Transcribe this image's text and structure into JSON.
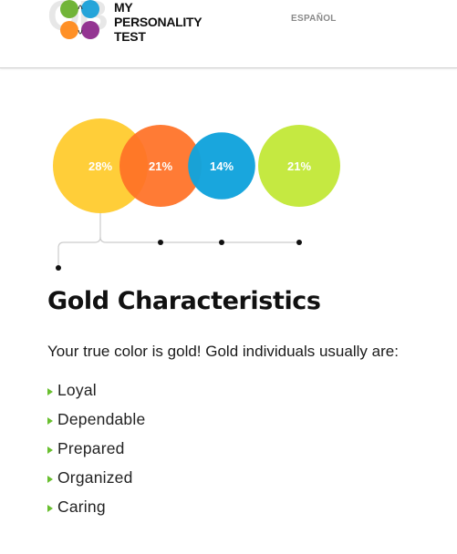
{
  "header": {
    "logo_lines": [
      "MY",
      "PERSONALITY",
      "TEST"
    ],
    "language_link": "ESPAÑOL",
    "colors": {
      "green": "#6ab12e",
      "blue": "#1aa0d8",
      "orange": "#ff8a1a",
      "purple": "#8e2a8c"
    }
  },
  "chart_data": {
    "type": "bubble",
    "bubbles": [
      {
        "label": "28%",
        "value": 28,
        "color": "#ffcc33"
      },
      {
        "label": "21%",
        "value": 21,
        "color": "#ff7126"
      },
      {
        "label": "14%",
        "value": 14,
        "color": "#12a3dc"
      },
      {
        "label": "21%",
        "value": 21,
        "color": "#c3e83b"
      }
    ],
    "selected_index": 0
  },
  "section": {
    "title": "Gold Characteristics",
    "intro": "Your true color is gold! Gold individuals usually are:",
    "traits": [
      "Loyal",
      "Dependable",
      "Prepared",
      "Organized",
      "Caring"
    ],
    "bullet_color": "#69bf2f"
  }
}
